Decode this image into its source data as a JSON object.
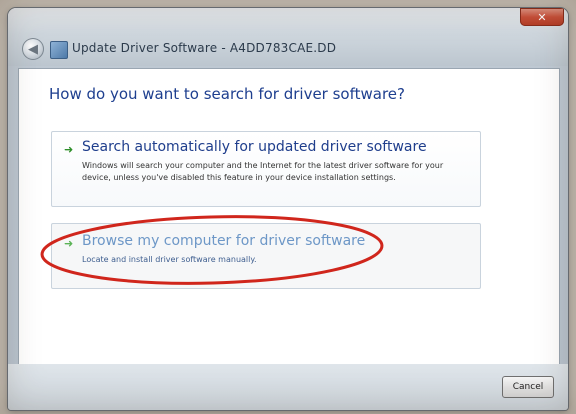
{
  "window": {
    "title": "Update Driver Software - A4DD783CAE.DD",
    "close_label": "✕",
    "back_label": "◀"
  },
  "main": {
    "heading": "How do you want to search for driver software?",
    "options": [
      {
        "title": "Search automatically for updated driver software",
        "description": "Windows will search your computer and the Internet for the latest driver software for your device, unless you've disabled this feature in your device installation settings."
      },
      {
        "title": "Browse my computer for driver software",
        "description": "Locate and install driver software manually."
      }
    ]
  },
  "footer": {
    "cancel_label": "Cancel"
  },
  "icons": {
    "option_arrow": "green-arrow-icon",
    "back": "back-arrow-icon",
    "close": "close-icon"
  },
  "colors": {
    "heading": "#1e3f8f",
    "annotation": "#d0261c"
  }
}
